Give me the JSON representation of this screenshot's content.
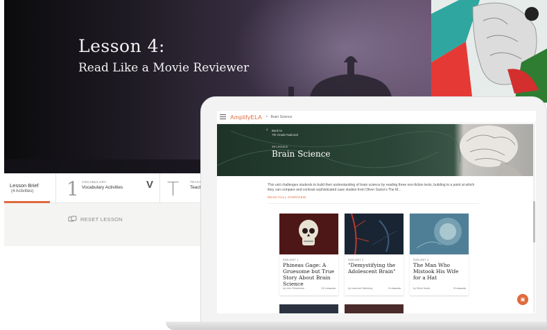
{
  "lesson": {
    "title_line1": "Lesson 4:",
    "title_line2": "Read Like a Movie Reviewer",
    "tabs": {
      "brief_label": "Lesson Brief",
      "brief_sub": "(4 Activities)",
      "vocab_number": "1",
      "vocab_small": "VOCABULARY",
      "vocab_label": "Vocabulary Activities",
      "vocab_badge": "V",
      "teacher_letter": "T",
      "teacher_small": "TEACHER",
      "teacher_label": "Teacher"
    },
    "reset_label": "RESET LESSON"
  },
  "app": {
    "brand": "AmplifyELA",
    "breadcrumb_sep": ">",
    "breadcrumb": "Brain Science"
  },
  "unit": {
    "back_line1": "Back to",
    "back_line2": "7th Grade National",
    "count_label": "26 Lessons",
    "title": "Brain Science",
    "description": "This unit challenges students to build their understanding of brain science by reading three non-fiction texts, building to a point at which they can compare and contrast sophisticated case studies from Oliver Sacks's The M...",
    "read_more": "READ FULL OVERVIEW"
  },
  "cards": [
    {
      "sub": "SUB-UNIT 1",
      "title": "Phineas Gage: A Gruesome but True Story About Brain Science",
      "by": "by John Fleischman",
      "count": "12 Lessons"
    },
    {
      "sub": "SUB-UNIT 2",
      "title": "\"Demystifying the Adolescent Brain\"",
      "by": "by Laurence Steinberg",
      "count": "4 Lessons"
    },
    {
      "sub": "SUB-UNIT 3",
      "title": "The Man Who Mistook His Wife for a Hat",
      "by": "by Oliver Sacks",
      "count": "3 Lessons"
    }
  ],
  "colors": {
    "accent": "#e0693c",
    "hero_dark": "#1d3328"
  },
  "icons": {
    "reset": "cards-reset-icon",
    "menu": "hamburger-icon",
    "back": "chevron-left-icon",
    "help": "help-chat-icon"
  }
}
